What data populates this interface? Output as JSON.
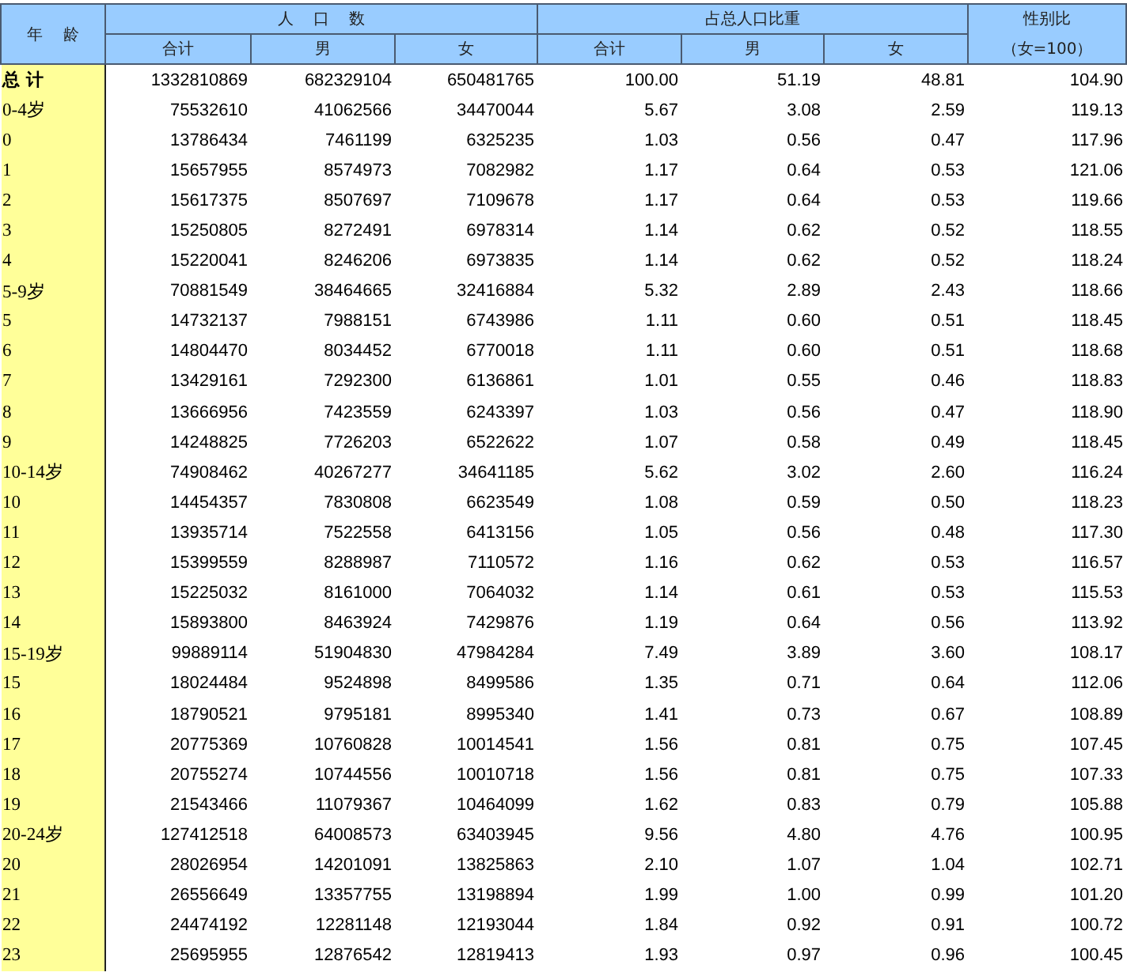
{
  "table": {
    "header": {
      "age": "年    龄",
      "population": "人    口    数",
      "share": "占总人口比重",
      "ratio": "性别比",
      "ratio_note": "（女=100）",
      "sub_population": [
        "合计",
        "男",
        "女"
      ],
      "sub_share": [
        "合计",
        "男",
        "女"
      ]
    },
    "rows": [
      {
        "kind": "total",
        "age": "总 计",
        "cells": [
          "1332810869",
          "682329104",
          "650481765",
          "100.00",
          "51.19",
          "48.81",
          "104.90"
        ]
      },
      {
        "kind": "age",
        "age": "0-4岁",
        "cells": [
          "75532610",
          "41062566",
          "34470044",
          "5.67",
          "3.08",
          "2.59",
          "119.13"
        ]
      },
      {
        "kind": "age",
        "age": "0",
        "cells": [
          "13786434",
          "7461199",
          "6325235",
          "1.03",
          "0.56",
          "0.47",
          "117.96"
        ]
      },
      {
        "kind": "age",
        "age": "1",
        "cells": [
          "15657955",
          "8574973",
          "7082982",
          "1.17",
          "0.64",
          "0.53",
          "121.06"
        ]
      },
      {
        "kind": "age",
        "age": "2",
        "cells": [
          "15617375",
          "8507697",
          "7109678",
          "1.17",
          "0.64",
          "0.53",
          "119.66"
        ]
      },
      {
        "kind": "age",
        "age": "3",
        "cells": [
          "15250805",
          "8272491",
          "6978314",
          "1.14",
          "0.62",
          "0.52",
          "118.55"
        ]
      },
      {
        "kind": "age",
        "age": "4",
        "cells": [
          "15220041",
          "8246206",
          "6973835",
          "1.14",
          "0.62",
          "0.52",
          "118.24"
        ]
      },
      {
        "kind": "age",
        "age": "5-9岁",
        "cells": [
          "70881549",
          "38464665",
          "32416884",
          "5.32",
          "2.89",
          "2.43",
          "118.66"
        ]
      },
      {
        "kind": "age",
        "age": "5",
        "cells": [
          "14732137",
          "7988151",
          "6743986",
          "1.11",
          "0.60",
          "0.51",
          "118.45"
        ]
      },
      {
        "kind": "age",
        "age": "6",
        "cells": [
          "14804470",
          "8034452",
          "6770018",
          "1.11",
          "0.60",
          "0.51",
          "118.68"
        ]
      },
      {
        "kind": "age",
        "age": "7",
        "cells": [
          "13429161",
          "7292300",
          "6136861",
          "1.01",
          "0.55",
          "0.46",
          "118.83"
        ]
      },
      {
        "kind": "age",
        "age": "8",
        "cells": [
          "13666956",
          "7423559",
          "6243397",
          "1.03",
          "0.56",
          "0.47",
          "118.90"
        ]
      },
      {
        "kind": "age",
        "age": "9",
        "cells": [
          "14248825",
          "7726203",
          "6522622",
          "1.07",
          "0.58",
          "0.49",
          "118.45"
        ]
      },
      {
        "kind": "age",
        "age": "10-14岁",
        "cells": [
          "74908462",
          "40267277",
          "34641185",
          "5.62",
          "3.02",
          "2.60",
          "116.24"
        ]
      },
      {
        "kind": "age",
        "age": "10",
        "cells": [
          "14454357",
          "7830808",
          "6623549",
          "1.08",
          "0.59",
          "0.50",
          "118.23"
        ]
      },
      {
        "kind": "age",
        "age": "11",
        "cells": [
          "13935714",
          "7522558",
          "6413156",
          "1.05",
          "0.56",
          "0.48",
          "117.30"
        ]
      },
      {
        "kind": "age",
        "age": "12",
        "cells": [
          "15399559",
          "8288987",
          "7110572",
          "1.16",
          "0.62",
          "0.53",
          "116.57"
        ]
      },
      {
        "kind": "age",
        "age": "13",
        "cells": [
          "15225032",
          "8161000",
          "7064032",
          "1.14",
          "0.61",
          "0.53",
          "115.53"
        ]
      },
      {
        "kind": "age",
        "age": "14",
        "cells": [
          "15893800",
          "8463924",
          "7429876",
          "1.19",
          "0.64",
          "0.56",
          "113.92"
        ]
      },
      {
        "kind": "age",
        "age": "15-19岁",
        "cells": [
          "99889114",
          "51904830",
          "47984284",
          "7.49",
          "3.89",
          "3.60",
          "108.17"
        ]
      },
      {
        "kind": "age",
        "age": "15",
        "cells": [
          "18024484",
          "9524898",
          "8499586",
          "1.35",
          "0.71",
          "0.64",
          "112.06"
        ]
      },
      {
        "kind": "age",
        "age": "16",
        "cells": [
          "18790521",
          "9795181",
          "8995340",
          "1.41",
          "0.73",
          "0.67",
          "108.89"
        ]
      },
      {
        "kind": "age",
        "age": "17",
        "cells": [
          "20775369",
          "10760828",
          "10014541",
          "1.56",
          "0.81",
          "0.75",
          "107.45"
        ]
      },
      {
        "kind": "age",
        "age": "18",
        "cells": [
          "20755274",
          "10744556",
          "10010718",
          "1.56",
          "0.81",
          "0.75",
          "107.33"
        ]
      },
      {
        "kind": "age",
        "age": "19",
        "cells": [
          "21543466",
          "11079367",
          "10464099",
          "1.62",
          "0.83",
          "0.79",
          "105.88"
        ]
      },
      {
        "kind": "age",
        "age": "20-24岁",
        "cells": [
          "127412518",
          "64008573",
          "63403945",
          "9.56",
          "4.80",
          "4.76",
          "100.95"
        ]
      },
      {
        "kind": "age",
        "age": "20",
        "cells": [
          "28026954",
          "14201091",
          "13825863",
          "2.10",
          "1.07",
          "1.04",
          "102.71"
        ]
      },
      {
        "kind": "age",
        "age": "21",
        "cells": [
          "26556649",
          "13357755",
          "13198894",
          "1.99",
          "1.00",
          "0.99",
          "101.20"
        ]
      },
      {
        "kind": "age",
        "age": "22",
        "cells": [
          "24474192",
          "12281148",
          "12193044",
          "1.84",
          "0.92",
          "0.91",
          "100.72"
        ]
      },
      {
        "kind": "age",
        "age": "23",
        "cells": [
          "25695955",
          "12876542",
          "12819413",
          "1.93",
          "0.97",
          "0.96",
          "100.45"
        ]
      }
    ]
  }
}
